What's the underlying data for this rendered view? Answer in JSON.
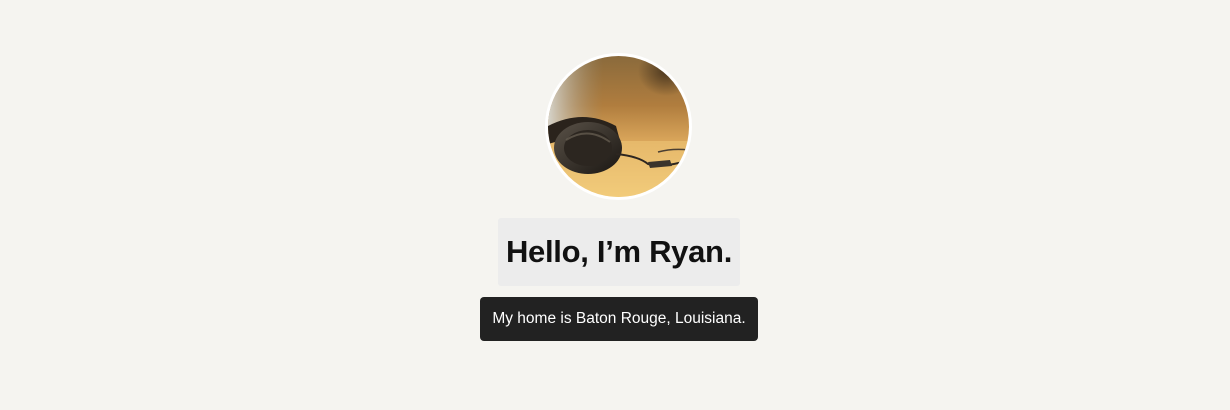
{
  "profile": {
    "avatar_alt": "headphones photo",
    "greeting": "Hello, I’m Ryan.",
    "location": "My home is Baton Rouge, Louisiana."
  },
  "colors": {
    "page_background": "#f5f4f0",
    "greeting_background": "#ececec",
    "location_background": "#222222",
    "location_text": "#ffffff"
  }
}
